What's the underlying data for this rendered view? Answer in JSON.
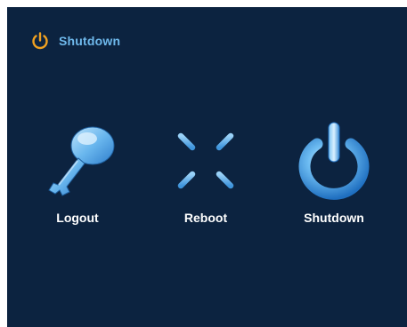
{
  "dialog": {
    "title": "Shutdown",
    "title_icon": "power-icon"
  },
  "actions": [
    {
      "label": "Logout",
      "icon": "key-icon"
    },
    {
      "label": "Reboot",
      "icon": "reboot-spinner-icon"
    },
    {
      "label": "Shutdown",
      "icon": "power-button-icon"
    }
  ],
  "colors": {
    "background": "#0c2340",
    "title_text": "#6fb9ec",
    "title_icon": "#f0a020",
    "label_text": "#ffffff",
    "icon_blue": "#5fb3ee"
  }
}
